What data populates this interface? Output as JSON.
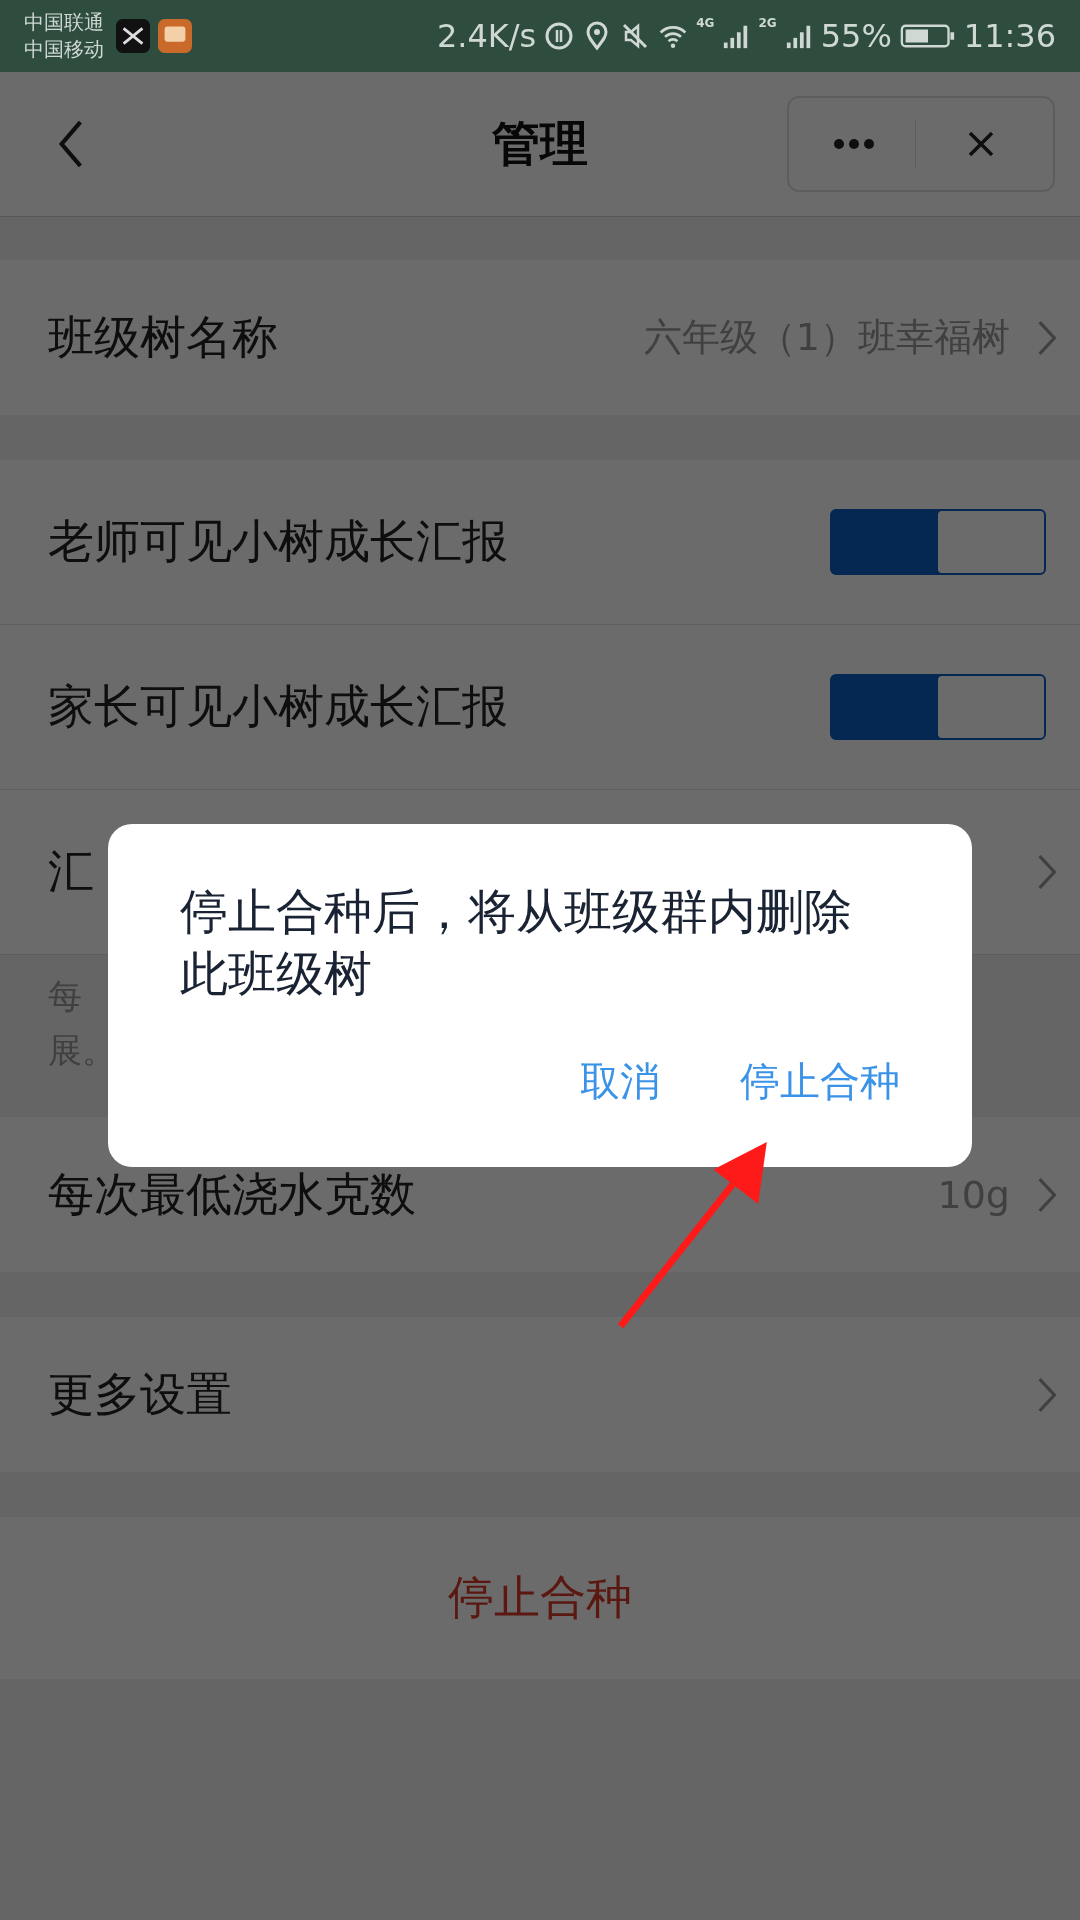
{
  "status_bar": {
    "carriers": [
      "中国联通",
      "中国移动"
    ],
    "speed": "2.4K/s",
    "networks": [
      "4G",
      "2G"
    ],
    "battery": "55%",
    "time": "11:36"
  },
  "header": {
    "title": "管理"
  },
  "sections": [
    {
      "rows": [
        {
          "kind": "link",
          "label": "班级树名称",
          "value": "六年级（1）班幸福树"
        }
      ]
    },
    {
      "rows": [
        {
          "kind": "toggle",
          "label": "老师可见小树成长汇报",
          "on": true
        },
        {
          "kind": "toggle",
          "label": "家长可见小树成长汇报",
          "on": true
        },
        {
          "kind": "link",
          "label": "汇"
        }
      ],
      "note": [
        "每",
        "展。"
      ]
    },
    {
      "rows": [
        {
          "kind": "link",
          "label": "每次最低浇水克数",
          "value": "10g"
        }
      ]
    },
    {
      "rows": [
        {
          "kind": "link",
          "label": "更多设置"
        }
      ]
    }
  ],
  "stop_button": "停止合种",
  "dialog": {
    "message": "停止合种后，将从班级群内删除此班级树",
    "buttons": [
      "取消",
      "停止合种"
    ]
  }
}
